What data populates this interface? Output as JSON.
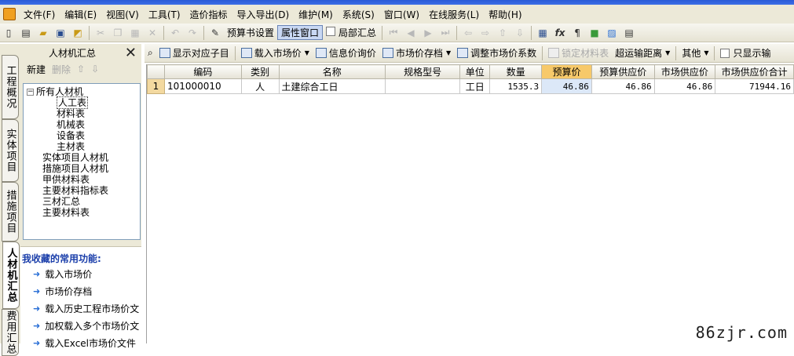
{
  "menu": [
    "文件(F)",
    "编辑(E)",
    "视图(V)",
    "工具(T)",
    "造价指标",
    "导入导出(D)",
    "维护(M)",
    "系统(S)",
    "窗口(W)",
    "在线服务(L)",
    "帮助(H)"
  ],
  "toolbar1": {
    "budget_settings": "预算书设置",
    "property_window": "属性窗口",
    "partial_summary": "局部汇总"
  },
  "vtabs": [
    "工程概况",
    "实体项目",
    "措施项目",
    "人材机汇总",
    "费用汇总"
  ],
  "left_panel": {
    "title": "人材机汇总",
    "new_label": "新建",
    "delete_label": "删除",
    "tree_root": "所有人材机",
    "tree_children": [
      "人工表",
      "材料表",
      "机械表",
      "设备表",
      "主材表"
    ],
    "tree_others": [
      "实体项目人材机",
      "措施项目人材机",
      "甲供材料表",
      "主要材料指标表",
      "三材汇总",
      "主要材料表"
    ],
    "favorites_title": "我收藏的常用功能:",
    "favorites": [
      "载入市场价",
      "市场价存档",
      "载入历史工程市场价文",
      "加权载入多个市场价文",
      "载入Excel市场价文件"
    ]
  },
  "toolbar2": {
    "show_subitem": "显示对应子目",
    "load_market_price": "载入市场价",
    "info_price_query": "信息价询价",
    "market_price_archive": "市场价存档",
    "adjust_coefficient": "调整市场价系数",
    "lock_material": "锁定材料表",
    "over_distance": "超运输距离",
    "other": "其他",
    "only_show": "只显示输"
  },
  "table": {
    "columns": [
      "编码",
      "类别",
      "名称",
      "规格型号",
      "单位",
      "数量",
      "预算价",
      "预算供应价",
      "市场供应价",
      "市场供应价合计"
    ],
    "rows": [
      {
        "rn": "1",
        "code": "101000010",
        "category": "人",
        "name": "土建综合工日",
        "spec": "",
        "unit": "工日",
        "qty": "1535.3",
        "budget_price": "46.86",
        "budget_supply": "46.86",
        "market_supply": "46.86",
        "market_total": "71944.16"
      }
    ]
  },
  "watermark": "86zjr.com",
  "colors": {
    "accent_blue": "#2a5bd7",
    "header_highlight": "#f7c96a",
    "row_number": "#f3d9a0"
  }
}
